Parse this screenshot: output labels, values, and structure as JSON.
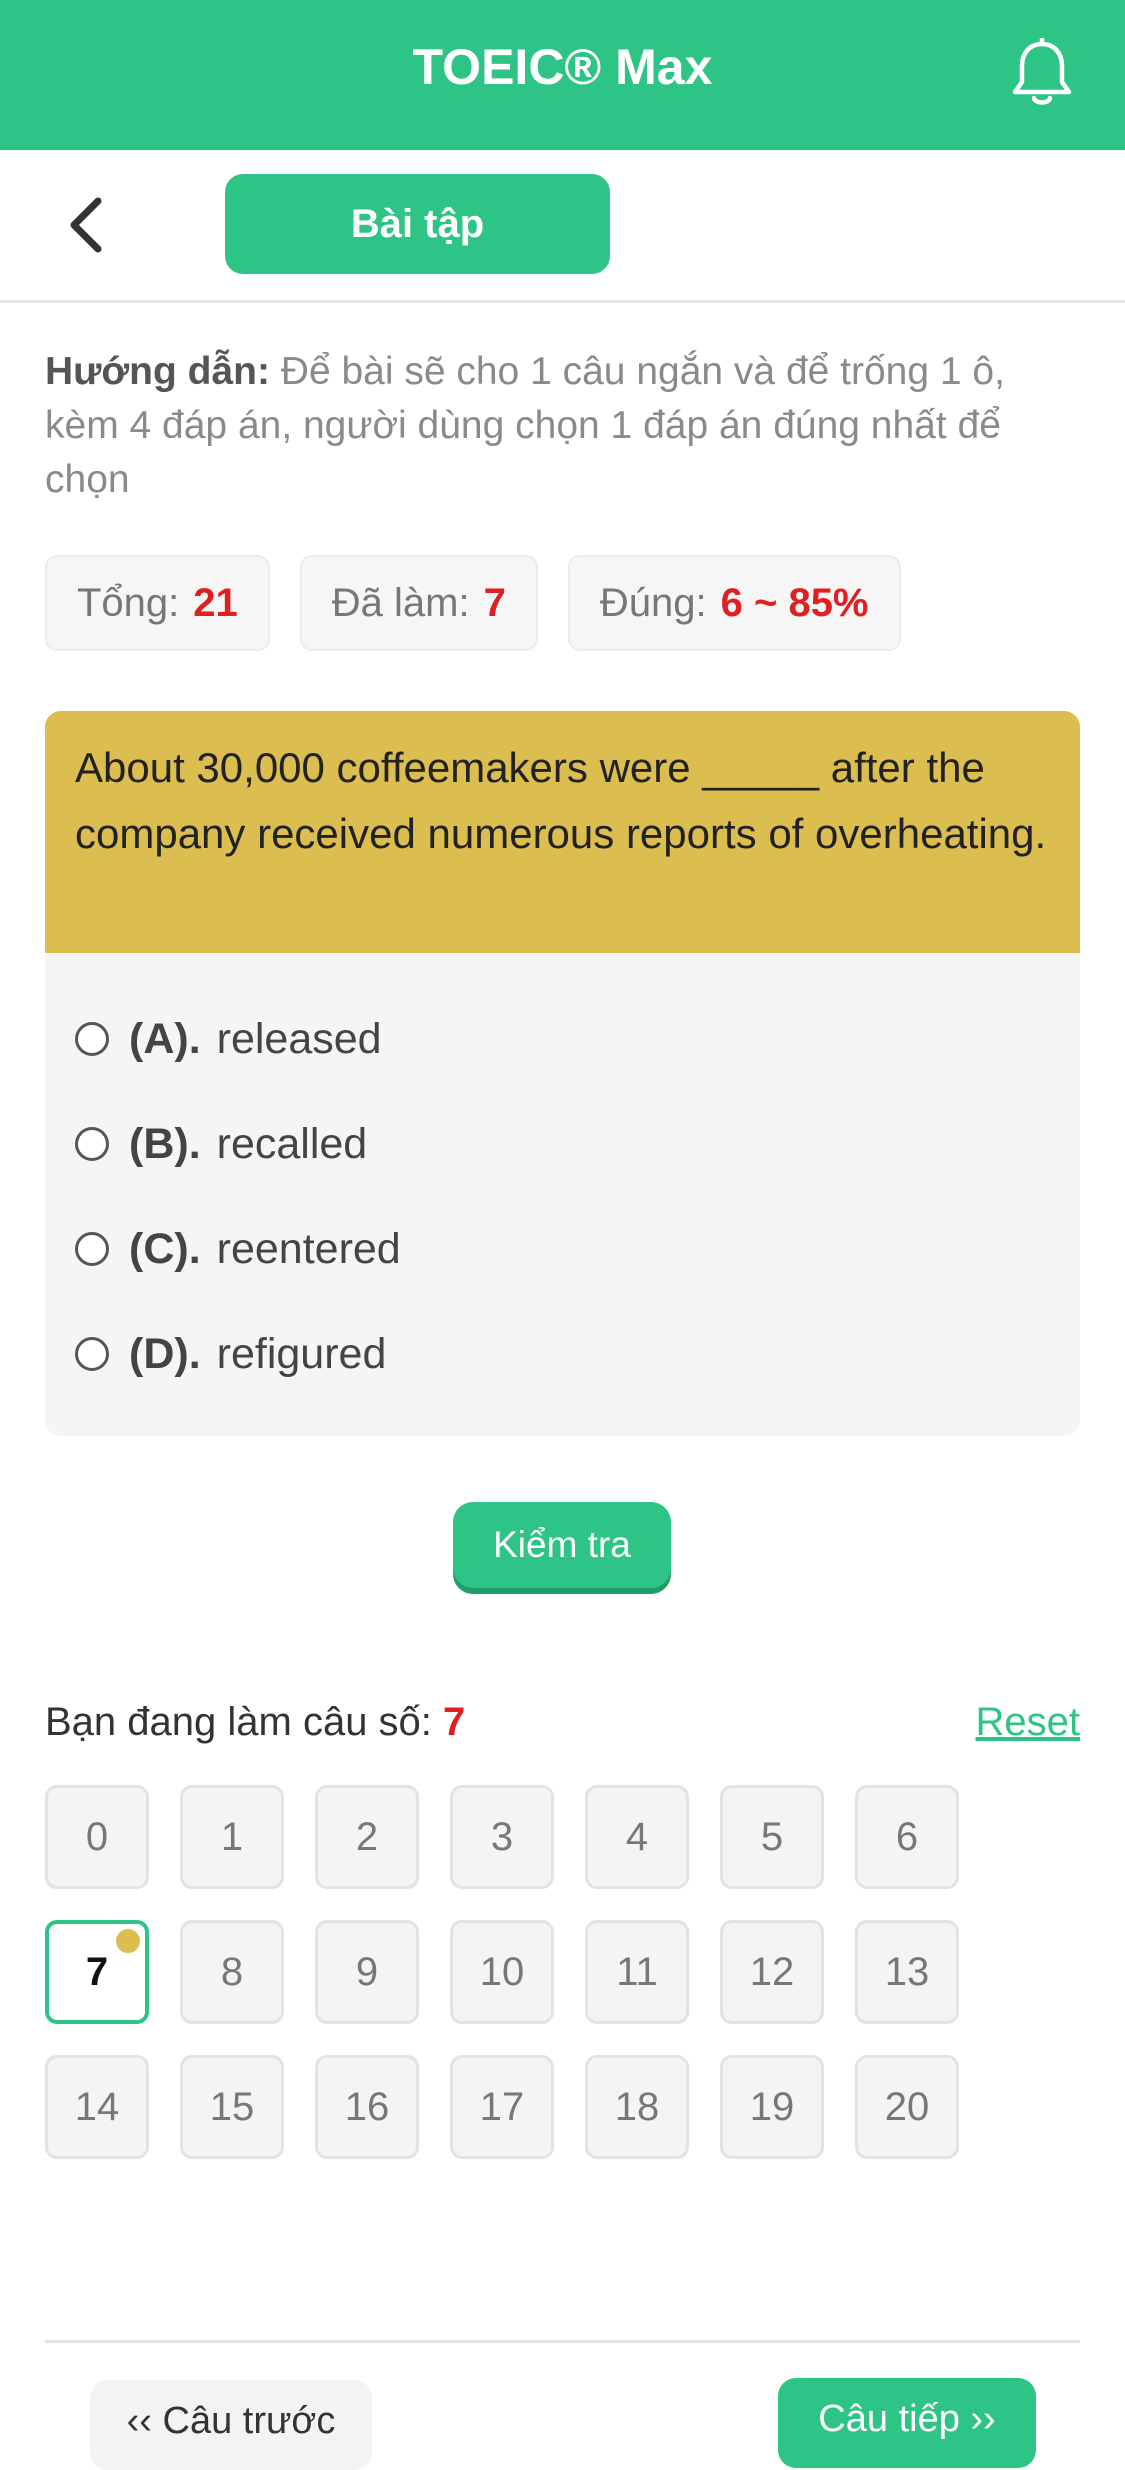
{
  "header": {
    "title": "TOEIC® Max",
    "icon": "bell-icon"
  },
  "subbar": {
    "back_icon": "chevron-left-icon",
    "tab_label": "Bài tập"
  },
  "guide": {
    "label": "Hướng dẫn:",
    "text": " Để bài sẽ cho 1 câu ngắn và để trống 1 ô, kèm 4 đáp án, người dùng chọn 1 đáp án đúng nhất để chọn"
  },
  "stats": [
    {
      "label": "Tổng:",
      "value": "21"
    },
    {
      "label": "Đã làm:",
      "value": "7"
    },
    {
      "label": "Đúng:",
      "value": "6 ~ 85%"
    }
  ],
  "question": {
    "text": "About 30,000 coffeemakers were _____ after the company received numerous reports of overheating.",
    "options": [
      {
        "letter": "(A).",
        "text": "released"
      },
      {
        "letter": "(B).",
        "text": "recalled"
      },
      {
        "letter": "(C).",
        "text": "reentered"
      },
      {
        "letter": "(D).",
        "text": "refigured"
      }
    ]
  },
  "check_button": "Kiểm tra",
  "progress": {
    "label": "Bạn đang làm câu số:",
    "current": "7",
    "reset": "Reset"
  },
  "numbers": [
    "0",
    "1",
    "2",
    "3",
    "4",
    "5",
    "6",
    "7",
    "8",
    "9",
    "10",
    "11",
    "12",
    "13",
    "14",
    "15",
    "16",
    "17",
    "18",
    "19",
    "20"
  ],
  "current_index": 7,
  "nav": {
    "prev": "‹‹ Câu trước",
    "next": "Câu tiếp ››"
  },
  "colors": {
    "primary": "#2ec486",
    "question_bg": "#dbbd50",
    "highlight": "#e02020"
  }
}
